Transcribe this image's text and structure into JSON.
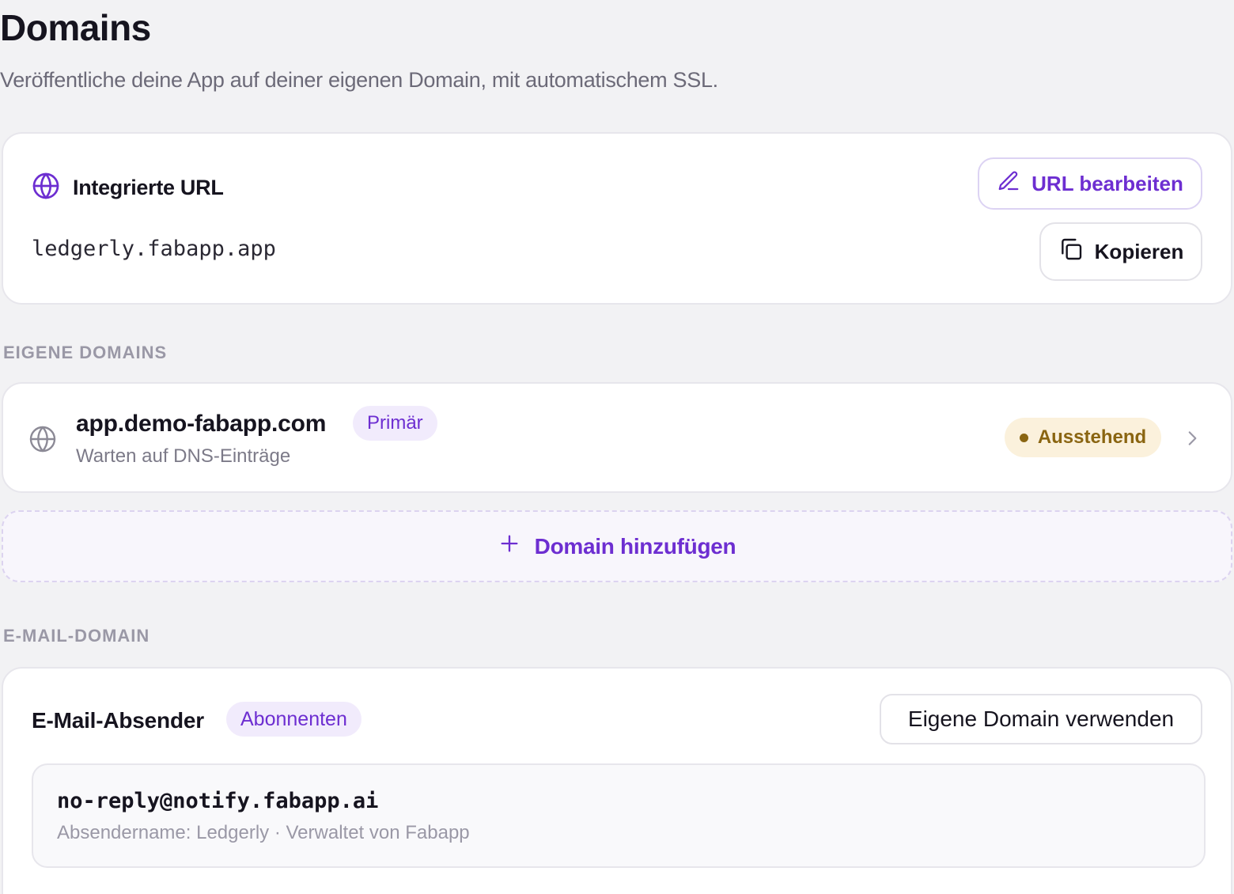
{
  "page": {
    "title": "Domains",
    "subtitle": "Veröffentliche deine App auf deiner eigenen Domain, mit automatischem SSL."
  },
  "builtin": {
    "title": "Integrierte URL",
    "url": "ledgerly.fabapp.app",
    "edit_label": "URL bearbeiten",
    "copy_label": "Kopieren"
  },
  "custom_domains": {
    "section_label": "EIGENE DOMAINS",
    "items": [
      {
        "name": "app.demo-fabapp.com",
        "badge": "Primär",
        "status_text": "Warten auf DNS-Einträge",
        "status_badge": "Ausstehend"
      }
    ],
    "add_label": "Domain hinzufügen"
  },
  "email_domain": {
    "section_label": "E-MAIL-DOMAIN",
    "title": "E-Mail-Absender",
    "badge": "Abonnenten",
    "button_label": "Eigene Domain verwenden",
    "address": "no-reply@notify.fabapp.ai",
    "meta": "Absendername: Ledgerly · Verwaltet von Fabapp"
  },
  "colors": {
    "accent": "#6d2ed1",
    "accent_bg": "#f1ebfc",
    "pending_fg": "#8a6511",
    "pending_bg": "#fbf1dc",
    "page_bg": "#f2f2f4"
  },
  "icons": {
    "builtin": "globe-icon",
    "edit": "pencil-icon",
    "copy": "copy-icon",
    "domain": "globe-icon",
    "row": "chevron-right-icon",
    "add": "plus-icon"
  }
}
